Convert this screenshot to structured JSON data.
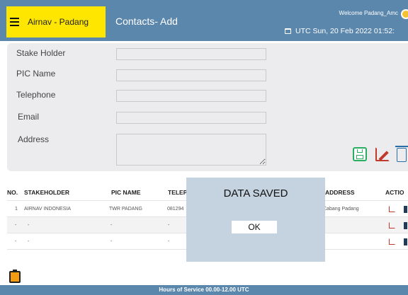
{
  "header": {
    "brand": "Airnav - Padang",
    "page_title": "Contacts- Add",
    "welcome": "Welcome Padang_Amc",
    "datetime": "UTC Sun, 20 Feb 2022 01:52:"
  },
  "form": {
    "stakeholder_label": "Stake Holder",
    "pic_label": "PIC Name",
    "telephone_label": "Telephone",
    "email_label": "Email",
    "address_label": "Address",
    "stakeholder_value": "",
    "pic_value": "",
    "telephone_value": "",
    "email_value": "",
    "address_value": ""
  },
  "table": {
    "headers": [
      "NO.",
      "STAKEHOLDER",
      "PIC NAME",
      "TELEP",
      "",
      "ADDRESS",
      "ACTIO"
    ],
    "rows": [
      [
        "1",
        "AIRNAV INDONESIA",
        "TWR PADANG",
        "081294",
        "",
        "Cabang Padang"
      ],
      [
        "-",
        "-",
        "-",
        "-",
        "",
        ""
      ],
      [
        "-",
        "-",
        "-",
        "-",
        "-",
        "-"
      ]
    ]
  },
  "dialog": {
    "message": "DATA SAVED",
    "ok_label": "OK"
  },
  "footer": {
    "hours": "Hours of Service 00.00-12.00 UTC"
  },
  "colors": {
    "header_bg": "#5b87ac",
    "brand_bg": "#ffe600",
    "save_green": "#27ae60",
    "edit_red": "#c0392b",
    "delete_blue": "#2b6ea6",
    "dialog_bg": "#c5d2df"
  },
  "icons": [
    "menu-icon",
    "calendar-icon",
    "avatar-icon",
    "save-icon",
    "edit-icon",
    "delete-icon",
    "clipboard-icon"
  ]
}
